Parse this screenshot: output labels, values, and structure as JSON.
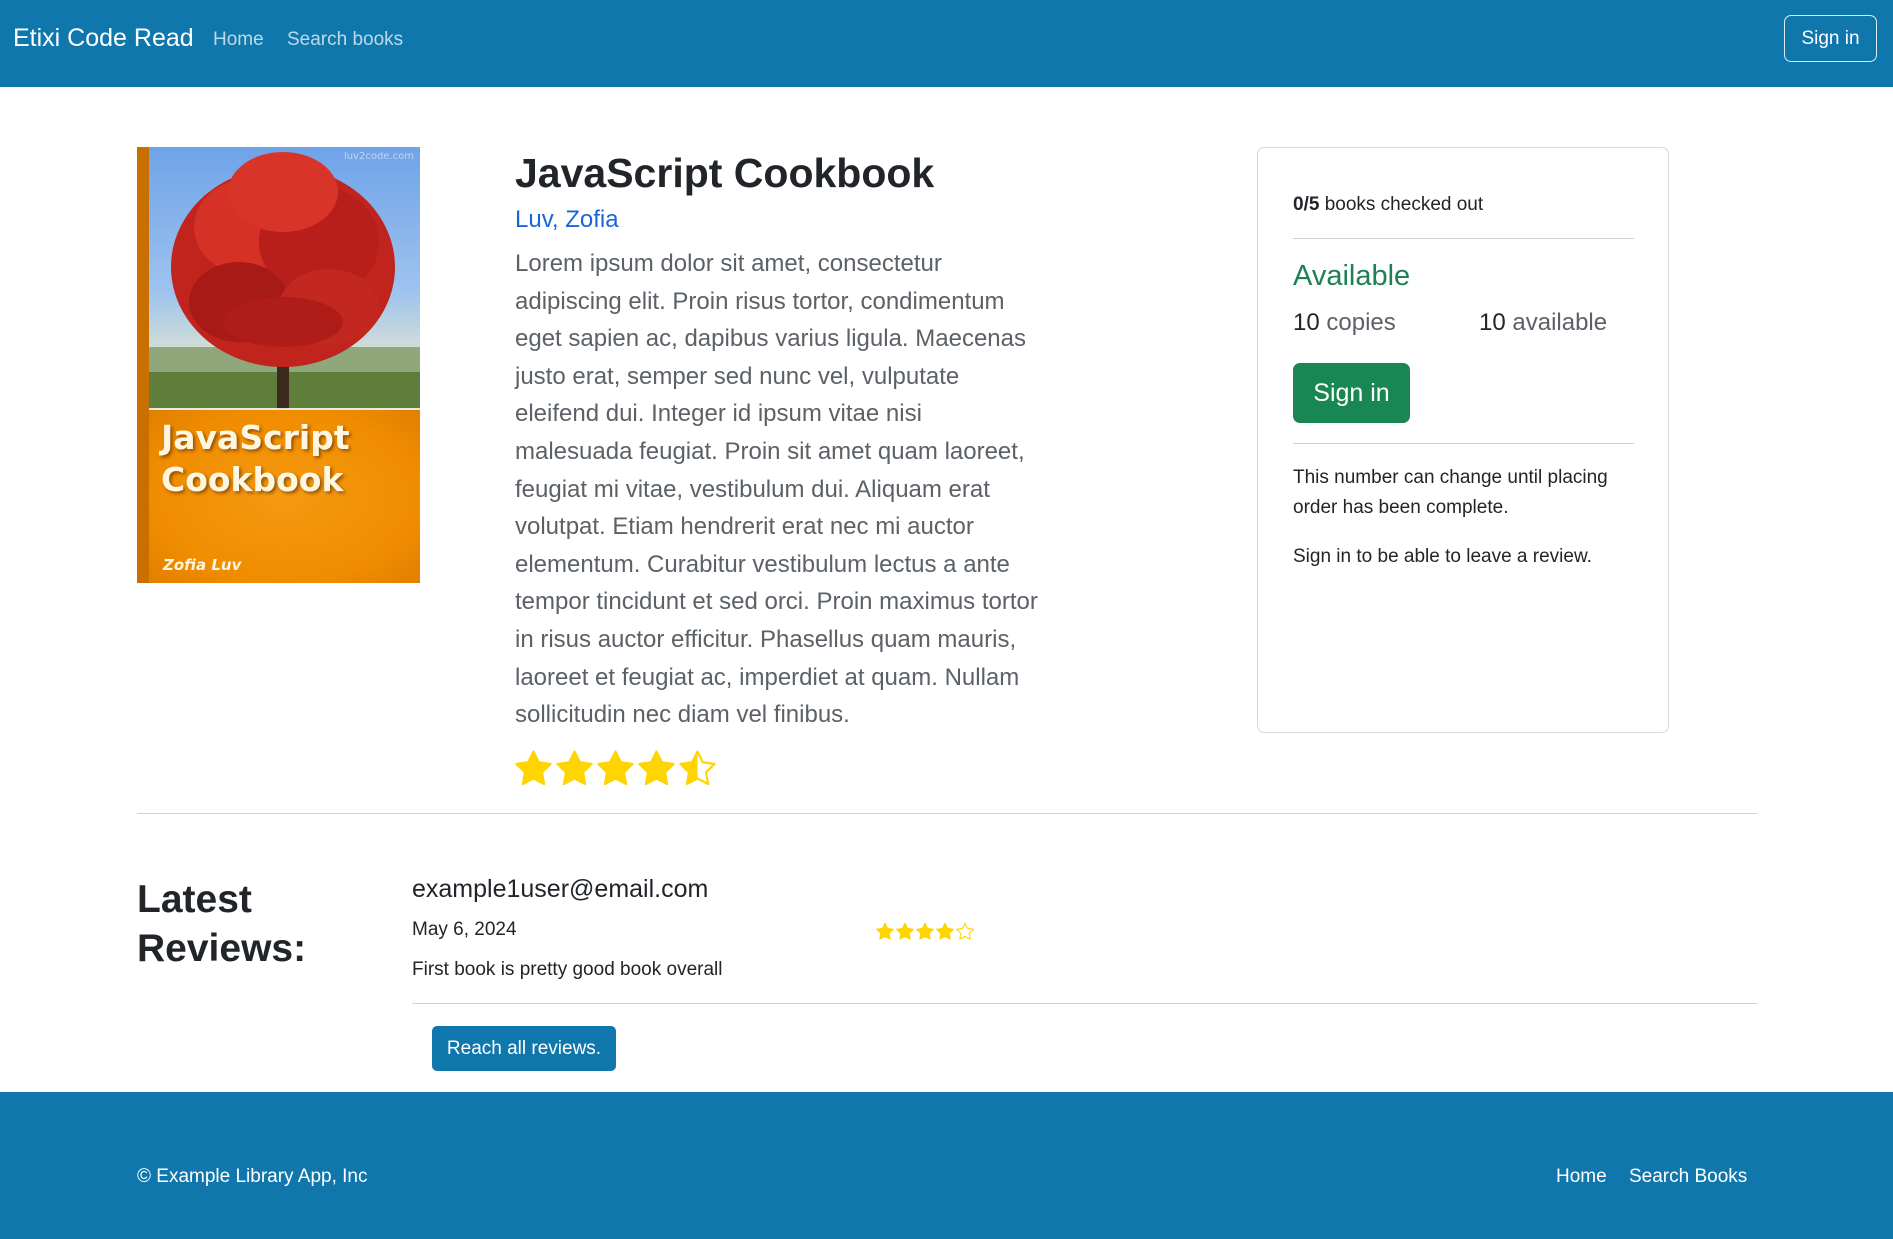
{
  "nav": {
    "brand": "Etixi Code Read",
    "home": "Home",
    "search": "Search books",
    "signin": "Sign in"
  },
  "book": {
    "cover_title": "JavaScript Cookbook",
    "cover_author": "Zofia Luv",
    "cover_watermark": "luv2code.com",
    "title": "JavaScript Cookbook",
    "author": "Luv, Zofia",
    "description": "Lorem ipsum dolor sit amet, consectetur adipiscing elit. Proin risus tortor, condimentum eget sapien ac, dapibus varius ligula. Maecenas justo erat, semper sed nunc vel, vulputate eleifend dui. Integer id ipsum vitae nisi malesuada feugiat. Proin sit amet quam laoreet, feugiat mi vitae, vestibulum dui. Aliquam erat volutpat. Etiam hendrerit erat nec mi auctor elementum. Curabitur vestibulum lectus a ante tempor tincidunt et sed orci. Proin maximus tortor in risus auctor efficitur. Phasellus quam mauris, laoreet et feugiat ac, imperdiet at quam. Nullam sollicitudin nec diam vel finibus.",
    "rating": 4.5,
    "rating_max": 5
  },
  "card": {
    "checked_out": "0/5",
    "checked_out_label": " books checked out",
    "status": "Available",
    "copies_num": "10",
    "copies_label": " copies",
    "available_num": "10",
    "available_label": " available",
    "signin": "Sign in",
    "note": "This number can change until placing order has been complete.",
    "review_note": "Sign in to be able to leave a review."
  },
  "reviews": {
    "heading": "Latest Reviews:",
    "items": [
      {
        "user": "example1user@email.com",
        "date": "May 6, 2024",
        "rating": 4,
        "rating_max": 5,
        "text": "First book is pretty good book overall"
      }
    ],
    "reach_all": "Reach all reviews."
  },
  "footer": {
    "copyright": "© Example Library App, Inc",
    "home": "Home",
    "search": "Search Books"
  },
  "colors": {
    "primary": "#0f77ac",
    "success": "#198754",
    "star": "#ffd500",
    "link": "#1a66d6"
  },
  "icons": {
    "star": "star-icon"
  }
}
